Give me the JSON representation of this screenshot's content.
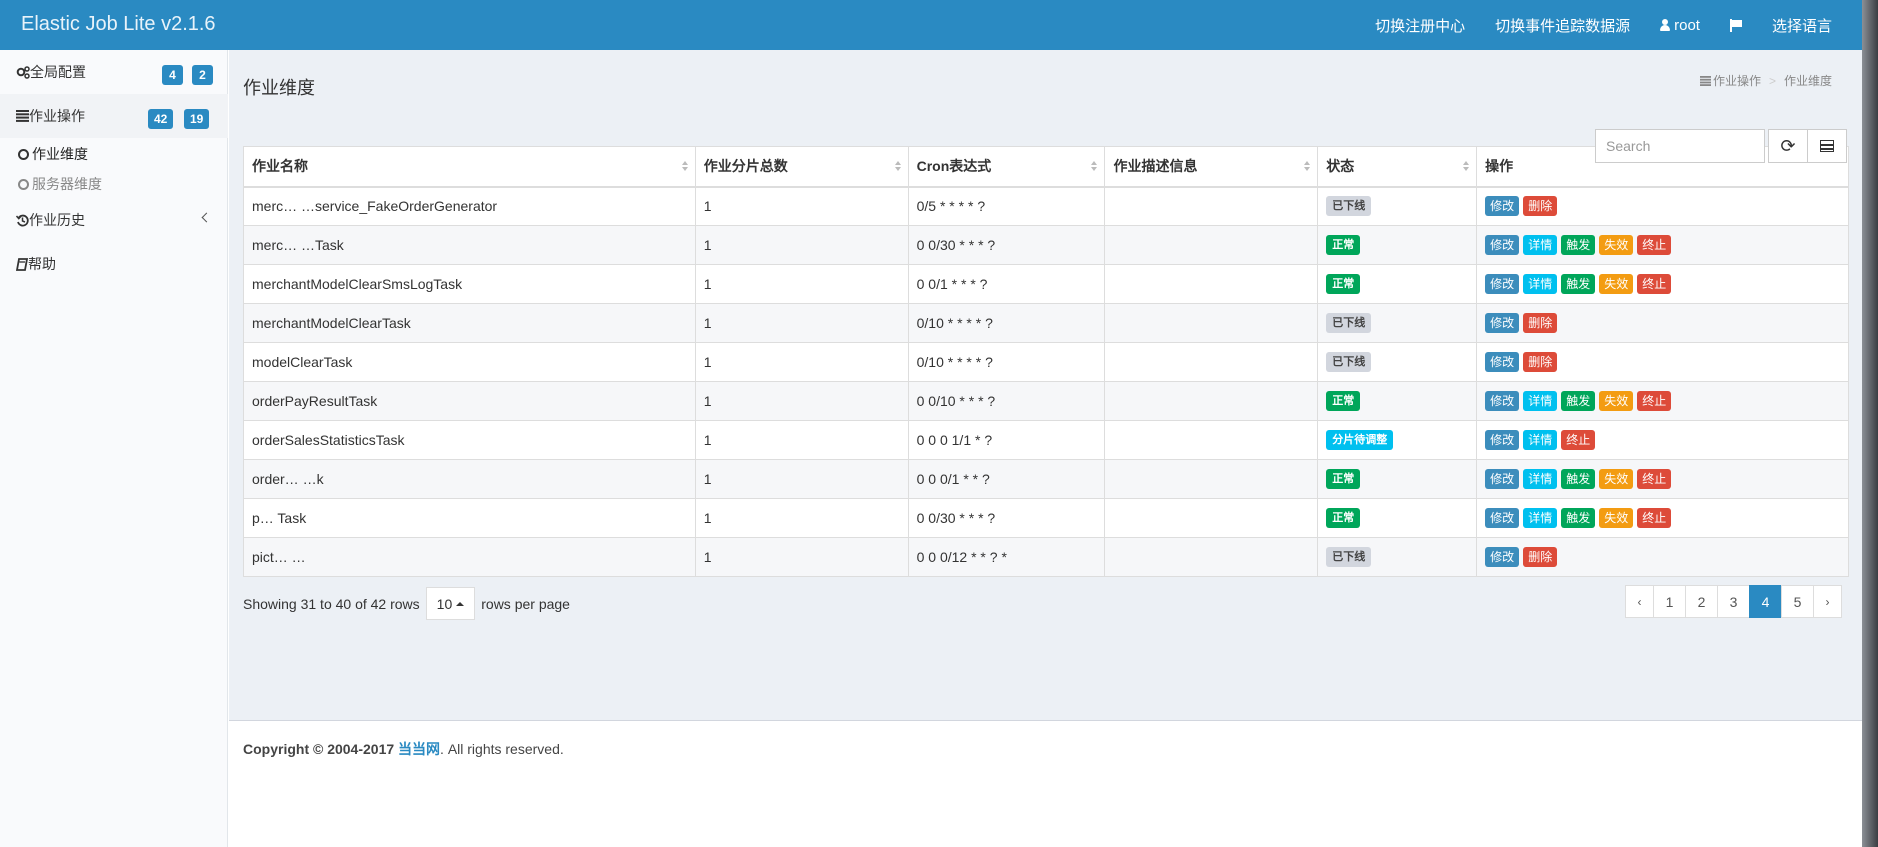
{
  "header": {
    "brand": "Elastic Job Lite v2.1.6",
    "nav": {
      "registry": "切换注册中心",
      "datasource": "切换事件追踪数据源",
      "user": "root",
      "language": "选择语言"
    }
  },
  "sidebar": {
    "global_config": {
      "label": "全局配置",
      "badge_a": "4",
      "badge_b": "2"
    },
    "job_ops": {
      "label": "作业操作",
      "badge_a": "42",
      "badge_b": "19"
    },
    "job_dimension": "作业维度",
    "server_dimension": "服务器维度",
    "job_history": "作业历史",
    "help": "帮助"
  },
  "main": {
    "title": "作业维度",
    "breadcrumb": {
      "parent": "作业操作",
      "current": "作业维度"
    },
    "search_placeholder": "Search",
    "columns": {
      "name": "作业名称",
      "sharding": "作业分片总数",
      "cron": "Cron表达式",
      "description": "作业描述信息",
      "status": "状态",
      "actions": "操作"
    },
    "rows": [
      {
        "name": "merc… …service_FakeOrderGenerator",
        "sharding": "1",
        "cron": "0/5 * * * * ?",
        "description": "",
        "status": "已下线",
        "status_type": "offline",
        "actions": [
          "修改",
          "删除"
        ]
      },
      {
        "name": "merc… …Task",
        "sharding": "1",
        "cron": "0 0/30 * * * ?",
        "description": "",
        "status": "正常",
        "status_type": "normal",
        "actions": [
          "修改",
          "详情",
          "触发",
          "失效",
          "终止"
        ]
      },
      {
        "name": "merchantModelClearSmsLogTask",
        "sharding": "1",
        "cron": "0 0/1 * * * ?",
        "description": "",
        "status": "正常",
        "status_type": "normal",
        "actions": [
          "修改",
          "详情",
          "触发",
          "失效",
          "终止"
        ]
      },
      {
        "name": "merchantModelClearTask",
        "sharding": "1",
        "cron": "0/10 * * * * ?",
        "description": "",
        "status": "已下线",
        "status_type": "offline",
        "actions": [
          "修改",
          "删除"
        ]
      },
      {
        "name": "modelClearTask",
        "sharding": "1",
        "cron": "0/10 * * * * ?",
        "description": "",
        "status": "已下线",
        "status_type": "offline",
        "actions": [
          "修改",
          "删除"
        ]
      },
      {
        "name": "orderPayResultTask",
        "sharding": "1",
        "cron": "0 0/10 * * * ?",
        "description": "",
        "status": "正常",
        "status_type": "normal",
        "actions": [
          "修改",
          "详情",
          "触发",
          "失效",
          "终止"
        ]
      },
      {
        "name": "orderSalesStatisticsTask",
        "sharding": "1",
        "cron": "0 0 0 1/1 * ?",
        "description": "",
        "status": "分片待调整",
        "status_type": "resharding",
        "actions": [
          "修改",
          "详情",
          "终止"
        ]
      },
      {
        "name": "order… …k",
        "sharding": "1",
        "cron": "0 0 0/1 * * ?",
        "description": "",
        "status": "正常",
        "status_type": "normal",
        "actions": [
          "修改",
          "详情",
          "触发",
          "失效",
          "终止"
        ]
      },
      {
        "name": "p… Task",
        "sharding": "1",
        "cron": "0 0/30 * * * ?",
        "description": "",
        "status": "正常",
        "status_type": "normal",
        "actions": [
          "修改",
          "详情",
          "触发",
          "失效",
          "终止"
        ]
      },
      {
        "name": "pict… …",
        "sharding": "1",
        "cron": "0 0 0/12 * * ? *",
        "description": "",
        "status": "已下线",
        "status_type": "offline",
        "actions": [
          "修改",
          "删除"
        ]
      }
    ],
    "pager": {
      "showing": "Showing 31 to 40 of 42 rows",
      "page_size": "10",
      "rows_per_page": "rows per page",
      "prev": "‹",
      "pages": [
        "1",
        "2",
        "3",
        "4",
        "5"
      ],
      "current": "4",
      "next": "›"
    }
  },
  "footer": {
    "prefix": "Copyright © 2004-2017",
    "link": "当当网",
    "suffix": ". All rights reserved."
  },
  "colors": {
    "header": "#2a8ac2",
    "content_bg": "#ecf0f5",
    "normal": "#00a65a",
    "offline": "#d2d6de",
    "resharding": "#00c0ef",
    "danger": "#dd4b39",
    "warning": "#f39c12"
  }
}
